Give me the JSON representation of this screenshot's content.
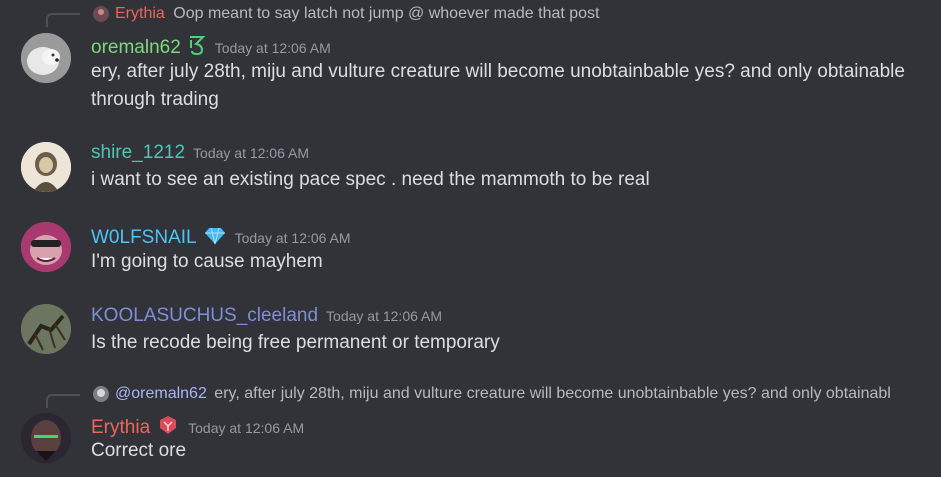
{
  "colors": {
    "background": "#313338",
    "timestamp": "#949ba4",
    "name_erythia": "#f0645a",
    "name_oremaln62": "#7fd87f",
    "name_shire": "#4fc6b4",
    "name_wolfsnail": "#4fc3f7",
    "name_koola": "#7e8fd8",
    "mention": "#a9b6f5"
  },
  "reply_top": {
    "author": "Erythia",
    "text": "Oop meant to say latch not jump @ whoever made that post"
  },
  "messages": [
    {
      "author": "oremaln62",
      "badge_icon": "green-symbol-icon",
      "timestamp": "Today at 12:06 AM",
      "text": "ery, after july 28th, miju and vulture creature will become unobtainbable yes? and only obtainable through trading"
    },
    {
      "author": "shire_1212",
      "timestamp": "Today at 12:06 AM",
      "text": "i want to see an existing pace spec . need the mammoth to be real"
    },
    {
      "author": "W0LFSNAIL",
      "badge_icon": "diamond-icon",
      "timestamp": "Today at 12:06 AM",
      "text": "I'm going to cause mayhem"
    },
    {
      "author": "KOOLASUCHUS_cleeland",
      "timestamp": "Today at 12:06 AM",
      "text": "Is the recode being free permanent or temporary"
    },
    {
      "author": "Erythia",
      "badge_icon": "red-emblem-icon",
      "timestamp": "Today at 12:06 AM",
      "text": "Correct ore"
    }
  ],
  "reply_bottom": {
    "mention": "@oremaln62",
    "text": "ery, after july 28th, miju and vulture creature will become unobtainbable yes? and only obtainabl"
  }
}
